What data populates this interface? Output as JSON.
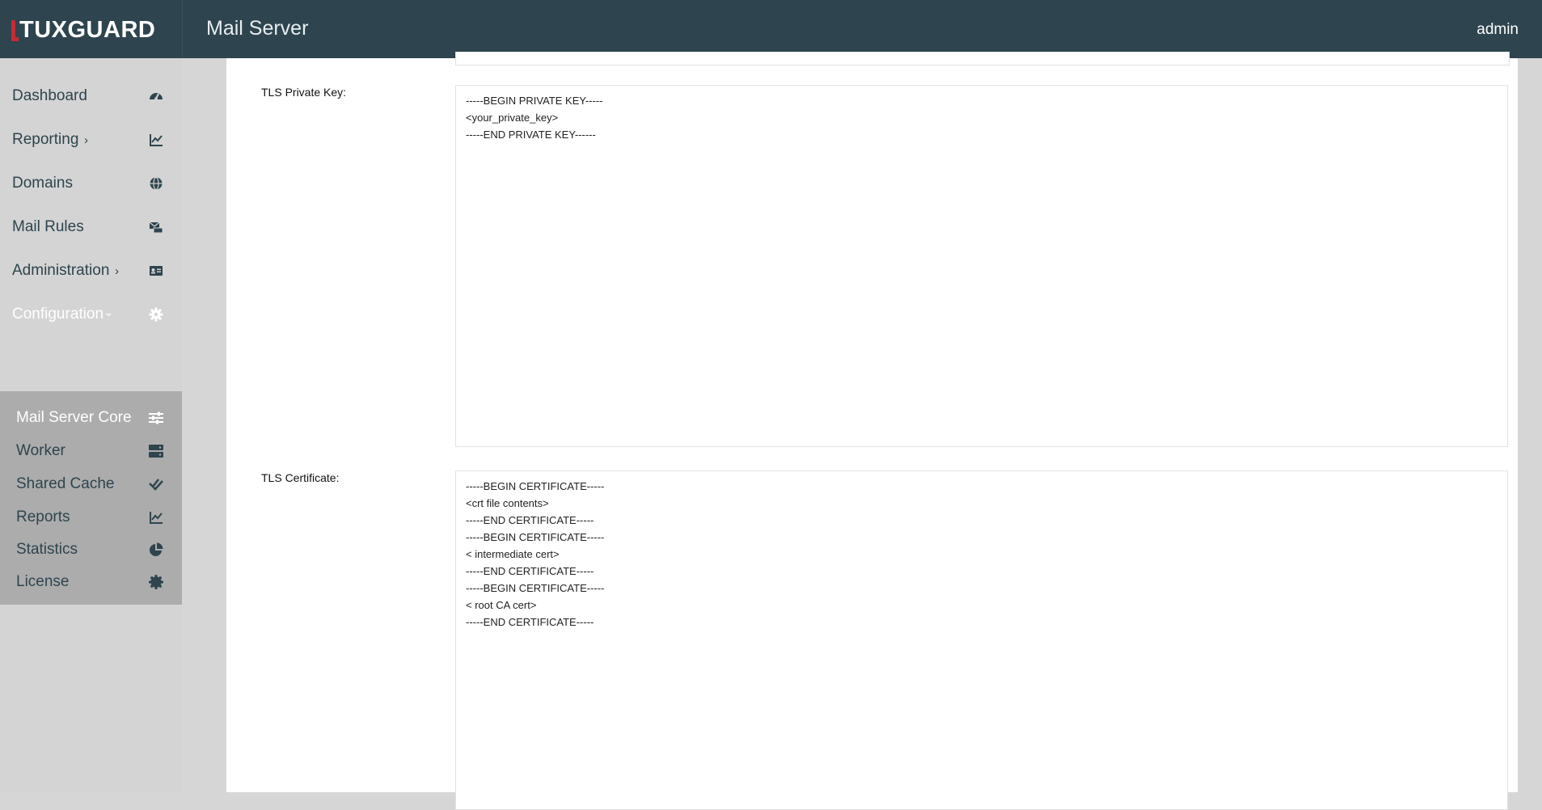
{
  "header": {
    "logo_text": "TUXGUARD",
    "app_title": "Mail Server",
    "user": "admin"
  },
  "sidebar": {
    "items": [
      {
        "label": "Dashboard",
        "icon": "dashboard-icon"
      },
      {
        "label": "Reporting",
        "icon": "chart-line-icon",
        "chevron": "›"
      },
      {
        "label": "Domains",
        "icon": "globe-icon"
      },
      {
        "label": "Mail Rules",
        "icon": "mail-rules-icon"
      },
      {
        "label": "Administration",
        "icon": "id-card-icon",
        "chevron": "›"
      },
      {
        "label": "Configuration",
        "icon": "gear-icon",
        "chevron": "⌄",
        "expanded": true
      }
    ],
    "submenu": [
      {
        "label": "Mail Server Core",
        "icon": "sliders-icon",
        "active": true
      },
      {
        "label": "Worker",
        "icon": "server-icon"
      },
      {
        "label": "Shared Cache",
        "icon": "double-check-icon"
      },
      {
        "label": "Reports",
        "icon": "chart-line-icon"
      },
      {
        "label": "Statistics",
        "icon": "pie-chart-icon"
      },
      {
        "label": "License",
        "icon": "certificate-icon"
      }
    ]
  },
  "form": {
    "private_key": {
      "label": "TLS Private Key:",
      "value": "-----BEGIN PRIVATE KEY-----\n<your_private_key>\n-----END PRIVATE KEY------"
    },
    "certificate": {
      "label": "TLS Certificate:",
      "value": "-----BEGIN CERTIFICATE-----\n<crt file contents>\n-----END CERTIFICATE-----\n-----BEGIN CERTIFICATE-----\n< intermediate cert>\n-----END CERTIFICATE-----\n-----BEGIN CERTIFICATE-----\n< root CA cert>\n-----END CERTIFICATE-----"
    }
  },
  "colors": {
    "header_bg": "#2e444e",
    "sidebar_bg": "#d4d4d4",
    "submenu_bg": "#acacac",
    "logo_accent": "#c62b33"
  }
}
